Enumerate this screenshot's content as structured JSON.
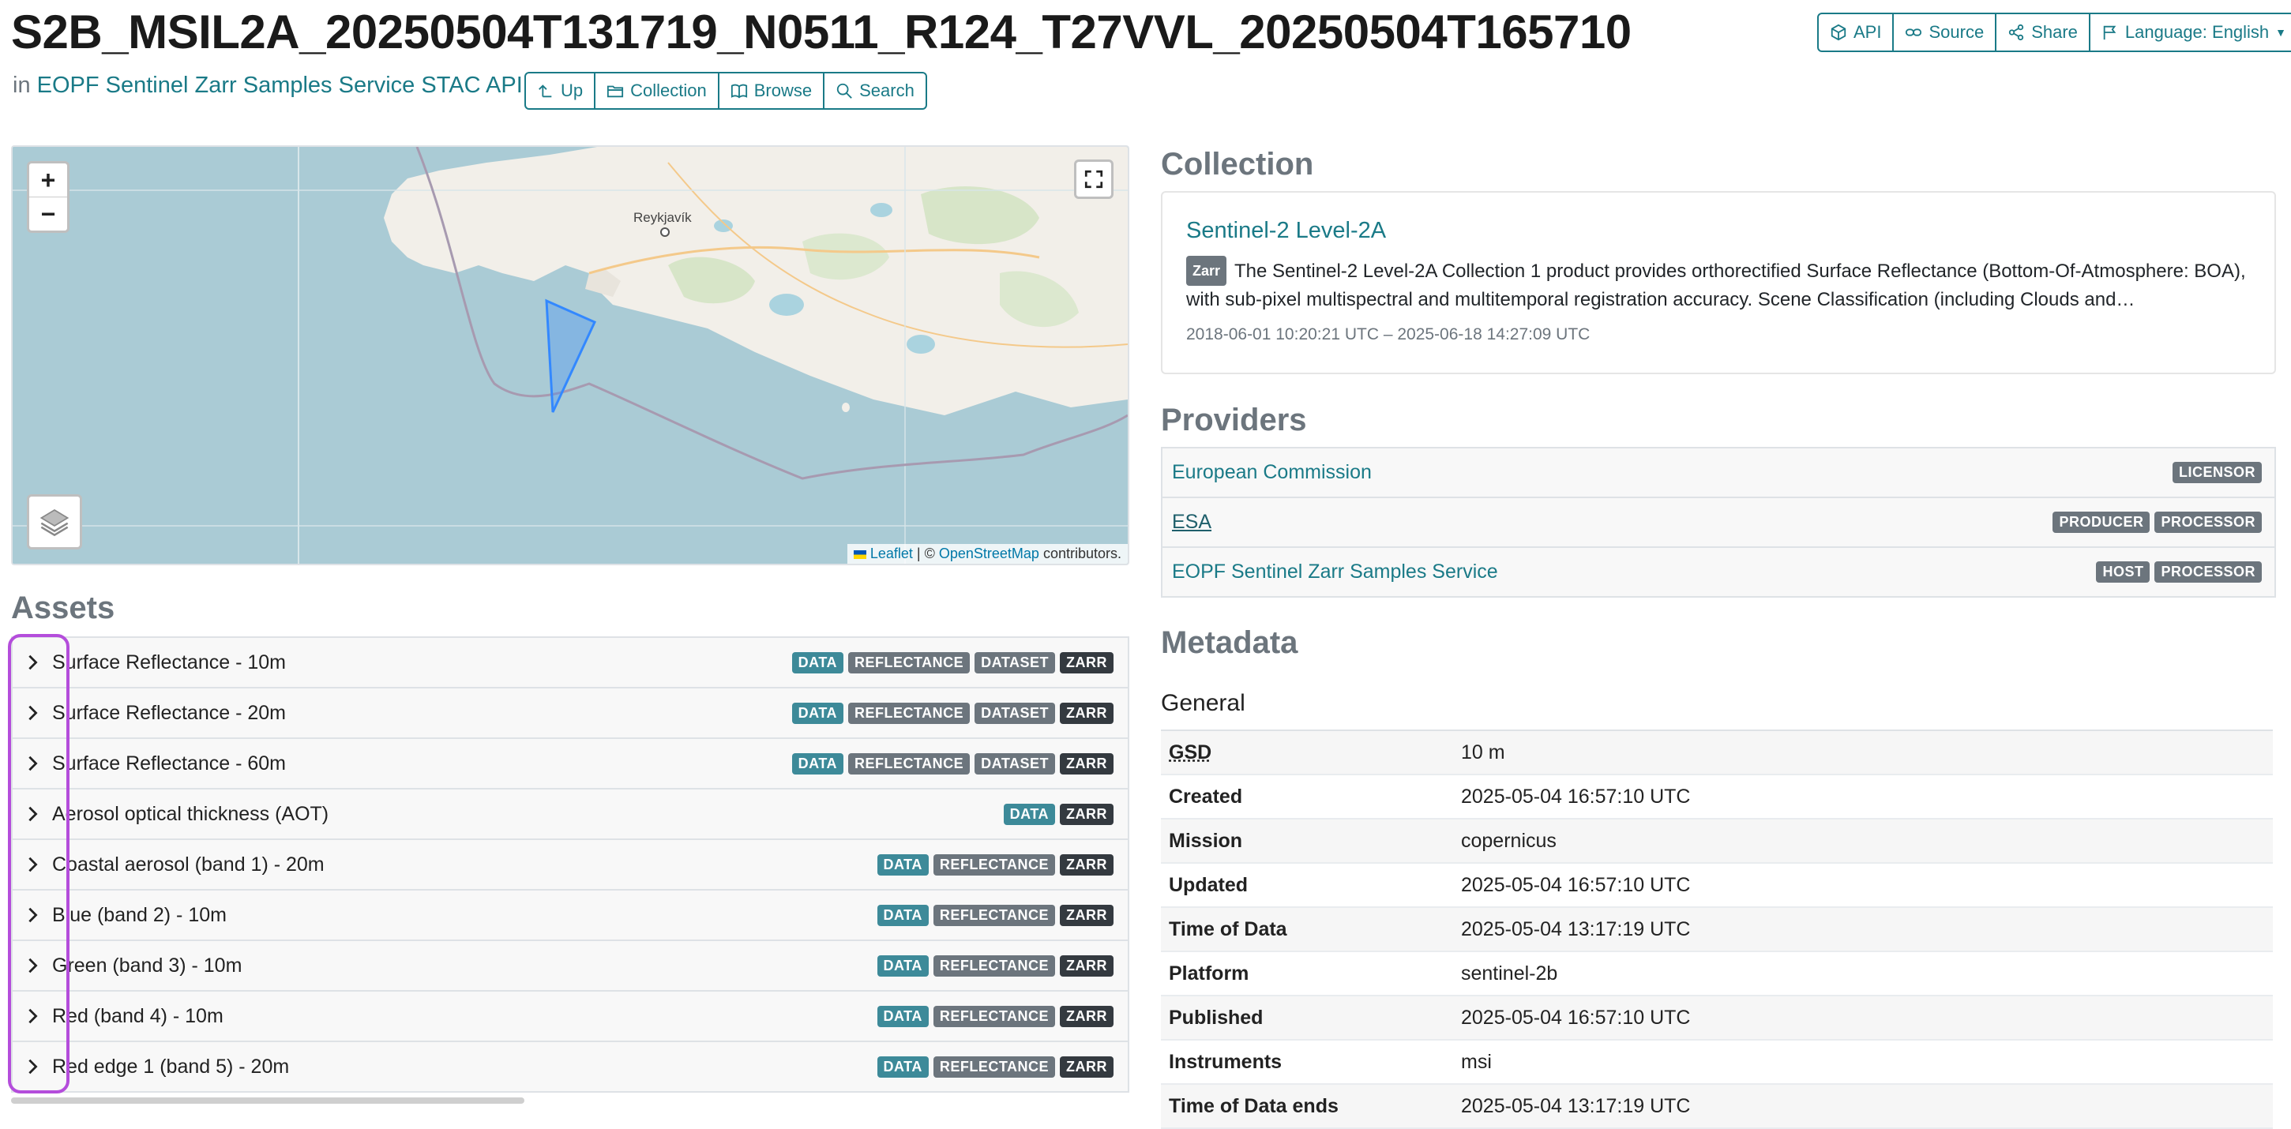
{
  "header": {
    "title": "S2B_MSIL2A_20250504T131719_N0511_R124_T27VVL_20250504T165710",
    "in_prefix": "in",
    "catalog_link": "EOPF Sentinel Zarr Samples Service STAC API",
    "nav_buttons": [
      "Up",
      "Collection",
      "Browse",
      "Search"
    ],
    "top_buttons": [
      "API",
      "Source",
      "Share",
      "Language: English"
    ]
  },
  "map": {
    "zoom_in": "+",
    "zoom_out": "−",
    "city_label": "Reykjavík",
    "attribution_leaflet": "Leaflet",
    "attribution_sep": "| ©",
    "attribution_osm": "OpenStreetMap",
    "attribution_suffix": "contributors.",
    "colors": {
      "water": "#aacbd5",
      "land": "#f2efe9",
      "footprint": "#3388ff"
    }
  },
  "assets": {
    "heading": "Assets",
    "items": [
      {
        "name": "Surface Reflectance - 10m",
        "badges": [
          "DATA",
          "REFLECTANCE",
          "DATASET",
          "ZARR"
        ]
      },
      {
        "name": "Surface Reflectance - 20m",
        "badges": [
          "DATA",
          "REFLECTANCE",
          "DATASET",
          "ZARR"
        ]
      },
      {
        "name": "Surface Reflectance - 60m",
        "badges": [
          "DATA",
          "REFLECTANCE",
          "DATASET",
          "ZARR"
        ]
      },
      {
        "name": "Aerosol optical thickness (AOT)",
        "badges": [
          "DATA",
          "ZARR"
        ]
      },
      {
        "name": "Coastal aerosol (band 1) - 20m",
        "badges": [
          "DATA",
          "REFLECTANCE",
          "ZARR"
        ]
      },
      {
        "name": "Blue (band 2) - 10m",
        "badges": [
          "DATA",
          "REFLECTANCE",
          "ZARR"
        ]
      },
      {
        "name": "Green (band 3) - 10m",
        "badges": [
          "DATA",
          "REFLECTANCE",
          "ZARR"
        ]
      },
      {
        "name": "Red (band 4) - 10m",
        "badges": [
          "DATA",
          "REFLECTANCE",
          "ZARR"
        ]
      },
      {
        "name": "Red edge 1 (band 5) - 20m",
        "badges": [
          "DATA",
          "REFLECTANCE",
          "ZARR"
        ]
      }
    ]
  },
  "collection": {
    "heading": "Collection",
    "title": "Sentinel-2 Level-2A",
    "badge": "Zarr",
    "description": "The Sentinel-2 Level-2A Collection 1 product provides orthorectified Surface Reflectance (Bottom-Of-Atmosphere: BOA), with sub-pixel multispectral and multitemporal registration accuracy. Scene Classification (including Clouds and…",
    "dates": "2018-06-01 10:20:21 UTC – 2025-06-18 14:27:09 UTC"
  },
  "providers": {
    "heading": "Providers",
    "items": [
      {
        "name": "European Commission",
        "roles": [
          "LICENSOR"
        ]
      },
      {
        "name": "ESA",
        "roles": [
          "PRODUCER",
          "PROCESSOR"
        ]
      },
      {
        "name": "EOPF Sentinel Zarr Samples Service",
        "roles": [
          "HOST",
          "PROCESSOR"
        ]
      }
    ]
  },
  "metadata": {
    "heading": "Metadata",
    "subheading": "General",
    "rows": [
      {
        "key": "GSD",
        "value": "10 m"
      },
      {
        "key": "Created",
        "value": "2025-05-04 16:57:10 UTC"
      },
      {
        "key": "Mission",
        "value": "copernicus"
      },
      {
        "key": "Updated",
        "value": "2025-05-04 16:57:10 UTC"
      },
      {
        "key": "Time of Data",
        "value": "2025-05-04 13:17:19 UTC"
      },
      {
        "key": "Platform",
        "value": "sentinel-2b"
      },
      {
        "key": "Published",
        "value": "2025-05-04 16:57:10 UTC"
      },
      {
        "key": "Instruments",
        "value": "msi"
      },
      {
        "key": "Time of Data ends",
        "value": "2025-05-04 13:17:19 UTC"
      }
    ]
  }
}
